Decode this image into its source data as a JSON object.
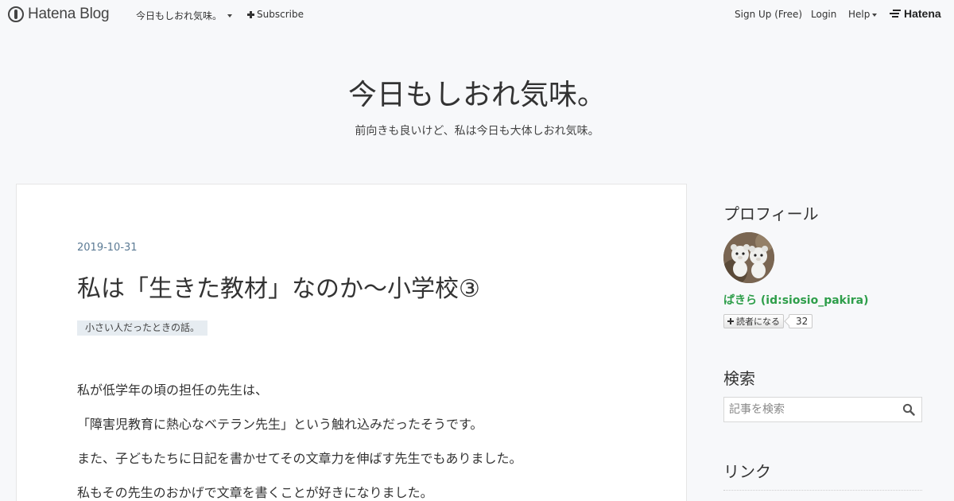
{
  "topbar": {
    "brand": "Hatena Blog",
    "blog_switch": "今日もしおれ気味。",
    "subscribe": "Subscribe",
    "signup": "Sign Up (Free)",
    "login": "Login",
    "help": "Help",
    "hatena": "Hatena"
  },
  "header": {
    "title": "今日もしおれ気味。",
    "description": "前向きも良いけど、私は今日も大体しおれ気味。"
  },
  "entry": {
    "date": "2019-10-31",
    "title": "私は「生きた教材」なのか〜小学校③",
    "category": "小さい人だったときの話。",
    "paragraphs": [
      "私が低学年の頃の担任の先生は、",
      "「障害児教育に熱心なベテラン先生」という触れ込みだったそうです。",
      "また、子どもたちに日記を書かせてその文章力を伸ばす先生でもありました。",
      "私もその先生のおかげで文章を書くことが好きになりました。"
    ]
  },
  "sidebar": {
    "profile_heading": "プロフィール",
    "profile_name": "ぱきら (id:siosio_pakira)",
    "reader_button": "読者になる",
    "reader_count": "32",
    "search_heading": "検索",
    "search_placeholder": "記事を検索",
    "links_heading": "リンク"
  },
  "colors": {
    "background": "#f7f8fa",
    "profile_name": "#2e9e4a",
    "date": "#5b7a94",
    "category_bg": "#e6ecf1"
  }
}
